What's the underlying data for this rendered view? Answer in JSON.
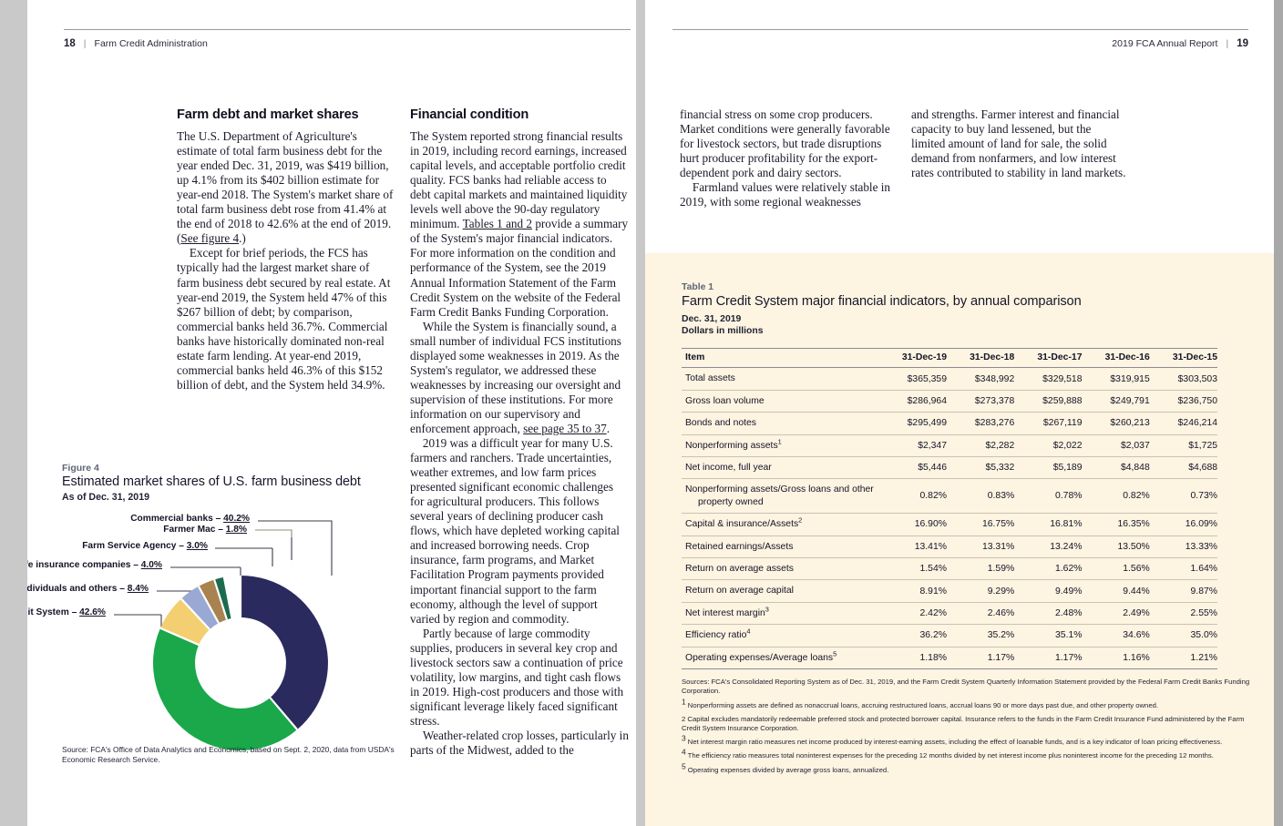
{
  "left_page": {
    "folio": "18",
    "divider": "|",
    "running_head": "Farm Credit Administration",
    "section_a_heading": "Farm debt and market shares",
    "section_a_paras": [
      "The U.S. Department of Agriculture's estimate of total farm business debt for the year ended Dec. 31, 2019, was $419 billion, up 4.1% from its $402 billion estimate for year-end 2018. The System's market share of total farm business debt rose from 41.4% at the end of 2018 to 42.6% at the end of 2019. (",
      "Except for brief periods, the FCS has typically had the largest market share of farm business debt secured by real estate. At year-end 2019, the System held 47% of this $267 billion of debt; by comparison, commercial banks held 36.7%. Commercial banks have historically dominated non-real estate farm lending. At year-end 2019, commercial banks held 46.3% of this $152 billion of debt, and the System held 34.9%."
    ],
    "section_a_link": "See figure 4",
    "section_a_link_tail": ".)",
    "section_b_heading": "Financial condition",
    "section_b_para1_pre": "The System reported strong financial results in 2019, including record earnings, increased capital levels, and acceptable portfolio credit quality. FCS banks had reliable access to debt capital markets and maintained liquidity levels well above the 90-day regulatory minimum. ",
    "section_b_link1": "Tables 1 and 2",
    "section_b_para1_post": " provide a summary of the System's major financial indicators. For more information on the condition and performance of the System, see the 2019 Annual Information Statement of the Farm Credit System on the website of the Federal Farm Credit Banks Funding Corporation.",
    "section_b_para2_pre": "While the System is financially sound, a small number of individual FCS institutions displayed some weaknesses in 2019. As the System's regulator, we addressed these weaknesses by increasing our oversight and supervision of these institutions. For more information on our supervisory and enforcement approach, ",
    "section_b_link2": "see page 35 to 37",
    "section_b_para2_post": ".",
    "section_b_para3": "2019 was a difficult year for many U.S. farmers and ranchers. Trade uncertainties, weather extremes, and low farm prices presented significant economic challenges for agricultural producers. This follows several years of declining producer cash flows, which have depleted working capital and increased borrowing needs. Crop insurance, farm programs, and Market Facilitation Program payments provided important financial support to the farm economy, although the level of support varied by region and commodity.",
    "section_b_para4": "Partly because of large commodity supplies, producers in several key crop and livestock sectors saw a continuation of price volatility, low margins, and tight cash flows in 2019. High-cost producers and those with significant leverage likely faced significant stress.",
    "section_b_para5": "Weather-related crop losses, particularly in parts of the Midwest, added to the"
  },
  "right_page": {
    "folio": "19",
    "divider": "|",
    "running_head": "2019 FCA Annual Report",
    "col_c_para1": "financial stress on some crop producers. Market conditions were generally favorable for livestock sectors, but trade disruptions hurt producer profitability for the export-dependent pork and dairy sectors.",
    "col_c_para2": "Farmland values were relatively stable in 2019, with some regional weaknesses",
    "col_d_para1": "and strengths. Farmer interest and financial capacity to buy land lessened, but the limited amount of land for sale, the solid demand from nonfarmers, and low interest rates contributed to stability in land markets."
  },
  "figure": {
    "kicker": "Figure 4",
    "title": "Estimated market shares of U.S. farm business debt",
    "subtitle": "As of Dec. 31, 2019",
    "source": "Source: FCA's Office of Data Analytics and Economics, based on Sept. 2, 2020, data from USDA's Economic Research Service."
  },
  "chart_data": {
    "type": "pie",
    "title": "Estimated market shares of U.S. farm business debt",
    "subtitle": "As of Dec. 31, 2019",
    "donut": true,
    "categories": [
      "Commercial banks",
      "Farm Credit System",
      "Individuals and others",
      "Life insurance companies",
      "Farm Service Agency",
      "Farmer Mac"
    ],
    "values": [
      40.2,
      42.6,
      8.4,
      4.0,
      3.0,
      1.8
    ],
    "value_suffix": "%",
    "colors": [
      "#2a2a5e",
      "#1aa84a",
      "#f4cf72",
      "#9aa8d4",
      "#a8824f",
      "#1c6b4f"
    ],
    "labels": [
      {
        "name": "Commercial banks",
        "sep": " – ",
        "value": "40.2%"
      },
      {
        "name": "Farmer Mac",
        "sep": " – ",
        "value": "1.8%"
      },
      {
        "name": "Farm Service Agency",
        "sep": " – ",
        "value": "3.0%"
      },
      {
        "name": "Life insurance companies",
        "sep": " – ",
        "value": "4.0%"
      },
      {
        "name": "Individuals and others",
        "sep": " – ",
        "value": "8.4%"
      },
      {
        "name": "Farm Credit System",
        "sep": " – ",
        "value": "42.6%"
      }
    ],
    "legend_position": "callout-labels",
    "source": "Source: FCA's Office of Data Analytics and Economics, based on Sept. 2, 2020, data from USDA's Economic Research Service."
  },
  "table": {
    "kicker": "Table 1",
    "title": "Farm Credit System major financial indicators, by annual comparison",
    "subtitle_line1": "Dec. 31, 2019",
    "subtitle_line2": "Dollars in millions",
    "columns": [
      "Item",
      "31-Dec-19",
      "31-Dec-18",
      "31-Dec-17",
      "31-Dec-16",
      "31-Dec-15"
    ],
    "rows": [
      {
        "item": "Total assets",
        "sup": "",
        "cont": "",
        "values": [
          "$365,359",
          "$348,992",
          "$329,518",
          "$319,915",
          "$303,503"
        ]
      },
      {
        "item": "Gross loan volume",
        "sup": "",
        "cont": "",
        "values": [
          "$286,964",
          "$273,378",
          "$259,888",
          "$249,791",
          "$236,750"
        ]
      },
      {
        "item": "Bonds and notes",
        "sup": "",
        "cont": "",
        "values": [
          "$295,499",
          "$283,276",
          "$267,119",
          "$260,213",
          "$246,214"
        ]
      },
      {
        "item": "Nonperforming assets",
        "sup": "1",
        "cont": "",
        "values": [
          "$2,347",
          "$2,282",
          "$2,022",
          "$2,037",
          "$1,725"
        ]
      },
      {
        "item": "Net income, full year",
        "sup": "",
        "cont": "",
        "values": [
          "$5,446",
          "$5,332",
          "$5,189",
          "$4,848",
          "$4,688"
        ]
      },
      {
        "item": "Nonperforming assets/Gross loans and other",
        "sup": "",
        "cont": "property owned",
        "values": [
          "0.82%",
          "0.83%",
          "0.78%",
          "0.82%",
          "0.73%"
        ]
      },
      {
        "item": "Capital & insurance/Assets",
        "sup": "2",
        "cont": "",
        "values": [
          "16.90%",
          "16.75%",
          "16.81%",
          "16.35%",
          "16.09%"
        ]
      },
      {
        "item": "Retained earnings/Assets",
        "sup": "",
        "cont": "",
        "values": [
          "13.41%",
          "13.31%",
          "13.24%",
          "13.50%",
          "13.33%"
        ]
      },
      {
        "item": "Return on average assets",
        "sup": "",
        "cont": "",
        "values": [
          "1.54%",
          "1.59%",
          "1.62%",
          "1.56%",
          "1.64%"
        ]
      },
      {
        "item": "Return on average capital",
        "sup": "",
        "cont": "",
        "values": [
          "8.91%",
          "9.29%",
          "9.49%",
          "9.44%",
          "9.87%"
        ]
      },
      {
        "item": "Net interest margin",
        "sup": "3",
        "cont": "",
        "values": [
          "2.42%",
          "2.46%",
          "2.48%",
          "2.49%",
          "2.55%"
        ]
      },
      {
        "item": "Efficiency ratio",
        "sup": "4",
        "cont": "",
        "values": [
          "36.2%",
          "35.2%",
          "35.1%",
          "34.6%",
          "35.0%"
        ]
      },
      {
        "item": "Operating expenses/Average loans",
        "sup": "5",
        "cont": "",
        "values": [
          "1.18%",
          "1.17%",
          "1.17%",
          "1.16%",
          "1.21%"
        ]
      }
    ],
    "notes": [
      {
        "num": "",
        "text": "Sources: FCA's Consolidated Reporting System as of Dec. 31, 2019, and the Farm Credit System Quarterly Information Statement provided by the Federal Farm Credit Banks Funding Corporation."
      },
      {
        "num": "1",
        "text": " Nonperforming assets are defined as nonaccrual loans, accruing restructured loans, accrual loans 90 or more days past due, and other property owned."
      },
      {
        "num": "",
        "text": "2 Capital excludes mandatorily redeemable preferred stock and protected borrower capital. Insurance refers to the funds in the Farm Credit Insurance Fund administered by the Farm Credit System Insurance Corporation."
      },
      {
        "num": "3",
        "text": " Net interest margin ratio measures net income produced by interest-earning assets, including the effect of loanable funds, and is a key indicator of loan pricing effectiveness."
      },
      {
        "num": "4",
        "text": " The efficiency ratio measures total noninterest expenses for the preceding 12 months divided by net interest income plus noninterest income for the preceding 12 months."
      },
      {
        "num": "5",
        "text": " Operating expenses divided by average gross loans, annualized."
      }
    ]
  }
}
